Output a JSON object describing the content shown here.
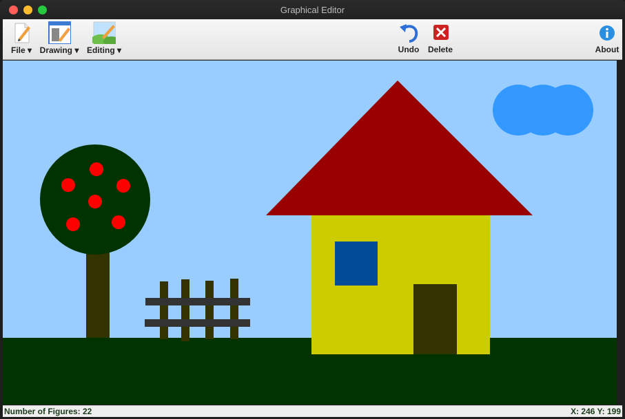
{
  "window": {
    "title": "Graphical Editor"
  },
  "toolbar": {
    "file_label": "File ▾",
    "drawing_label": "Drawing ▾",
    "editing_label": "Editing ▾",
    "undo_label": "Undo",
    "delete_label": "Delete",
    "about_label": "About",
    "icons": {
      "file": "document-pencil-icon",
      "drawing": "drawing-board-icon",
      "editing": "landscape-pencil-icon",
      "undo": "undo-arrow-icon",
      "delete": "delete-x-icon",
      "about": "info-icon"
    }
  },
  "status": {
    "figures_text": "Number of Figures: 22",
    "coords_text": "X: 246  Y: 199"
  },
  "colors": {
    "sky": "#99ccff",
    "grass": "#003300",
    "roof": "#990000",
    "wall": "#cccc00",
    "window": "#004c99",
    "door": "#333300",
    "trunk": "#333300",
    "foliage": "#003300",
    "apple": "#ff0000",
    "cloud": "#3399ff",
    "fence": "#333333"
  }
}
